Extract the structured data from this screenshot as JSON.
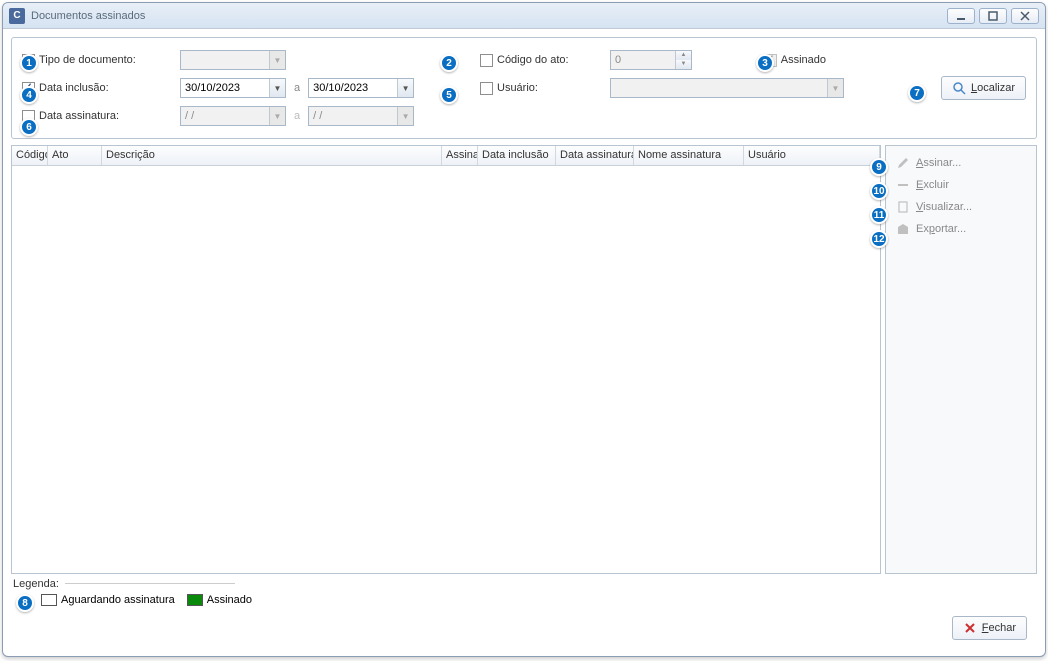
{
  "window": {
    "title": "Documentos assinados"
  },
  "filters": {
    "tipo_doc": {
      "label": "Tipo de documento:",
      "checked": false
    },
    "codigo_ato": {
      "label": "Código do ato:",
      "checked": false,
      "value": "0"
    },
    "assinado": {
      "label": "Assinado",
      "checked": true
    },
    "data_inclusao": {
      "label": "Data inclusão:",
      "checked": true,
      "from": "30/10/2023",
      "to": "30/10/2023",
      "sep": "a"
    },
    "usuario": {
      "label": "Usuário:",
      "checked": false
    },
    "data_assinatura": {
      "label": "Data assinatura:",
      "checked": false,
      "from": "  /  /",
      "to": "  /  /",
      "sep": "a"
    }
  },
  "buttons": {
    "localizar": "Localizar",
    "fechar": "Fechar"
  },
  "grid": {
    "columns": [
      "Código",
      "Ato",
      "Descrição",
      "Assinado",
      "Data inclusão",
      "Data assinatura",
      "Nome assinatura",
      "Usuário"
    ]
  },
  "actions": {
    "assinar": "Assinar...",
    "excluir": "Excluir",
    "visualizar": "Visualizar...",
    "exportar": "Exportar..."
  },
  "legend": {
    "label": "Legenda:",
    "aguardando": "Aguardando assinatura",
    "assinado": "Assinado"
  },
  "callouts": [
    "1",
    "2",
    "3",
    "4",
    "5",
    "6",
    "7",
    "8",
    "9",
    "10",
    "11",
    "12"
  ]
}
